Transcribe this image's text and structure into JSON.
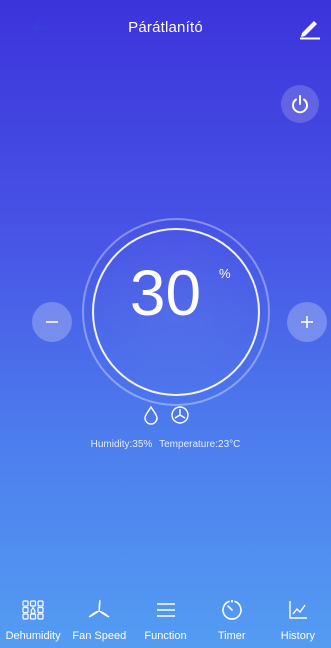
{
  "header": {
    "title": "Párátlanító",
    "back_icon": "arrow-left-icon",
    "edit_icon": "pencil-icon"
  },
  "power": {
    "icon": "power-icon"
  },
  "target": {
    "value": "30",
    "unit": "%"
  },
  "controls": {
    "minus_icon": "minus-icon",
    "plus_icon": "plus-icon"
  },
  "mode_icons": [
    "water-drop-icon",
    "fan-clock-icon"
  ],
  "status": {
    "humidity": "Humidity:35%",
    "temperature": "Temperature:23°C"
  },
  "tabs": [
    {
      "label": "Dehumidity",
      "icon": "grid-drop-icon"
    },
    {
      "label": "Fan Speed",
      "icon": "fan-icon"
    },
    {
      "label": "Function",
      "icon": "menu-icon"
    },
    {
      "label": "Timer",
      "icon": "timer-icon"
    },
    {
      "label": "History",
      "icon": "chart-icon"
    }
  ],
  "colors": {
    "gradient_top": "#3c33db",
    "gradient_bottom": "#549cf2"
  }
}
